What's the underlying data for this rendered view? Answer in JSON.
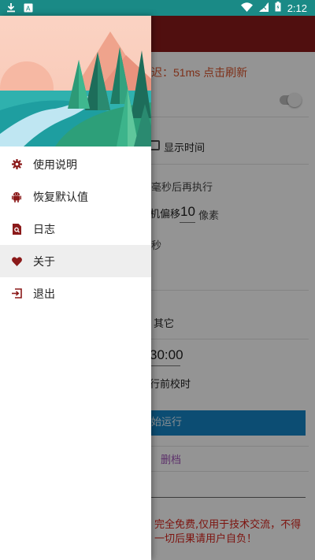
{
  "status_bar": {
    "time": "2:12",
    "left_icons": [
      "download-icon",
      "app-store-icon"
    ],
    "right_icons": [
      "wifi-icon",
      "signal-icon",
      "battery-icon"
    ],
    "background": "#1a8a86"
  },
  "app": {
    "toolbar_color": "#8b1a1a",
    "latency_text": "迟：51ms  点击刷新",
    "show_time_label": "显示时间",
    "delay_text": "毫秒后再执行",
    "offset_prefix": "机偏移",
    "offset_value": "10",
    "offset_unit": "像素",
    "seconds_text": "秒",
    "other_label": "其它",
    "time_value": "30:00",
    "calibrate_text": "行前校时",
    "run_button": "始运行",
    "purple_link": "删档",
    "footer_text": "完全免费,仅用于技术交流，不得一切后果请用户自负！"
  },
  "drawer": {
    "menu": [
      {
        "label": "使用说明",
        "icon": "gear-icon",
        "active": false
      },
      {
        "label": "恢复默认值",
        "icon": "android-icon",
        "active": false
      },
      {
        "label": "日志",
        "icon": "document-search-icon",
        "active": false
      },
      {
        "label": "关于",
        "icon": "heart-icon",
        "active": true
      },
      {
        "label": "退出",
        "icon": "exit-icon",
        "active": false
      }
    ],
    "accent_color": "#8b1a1a"
  }
}
